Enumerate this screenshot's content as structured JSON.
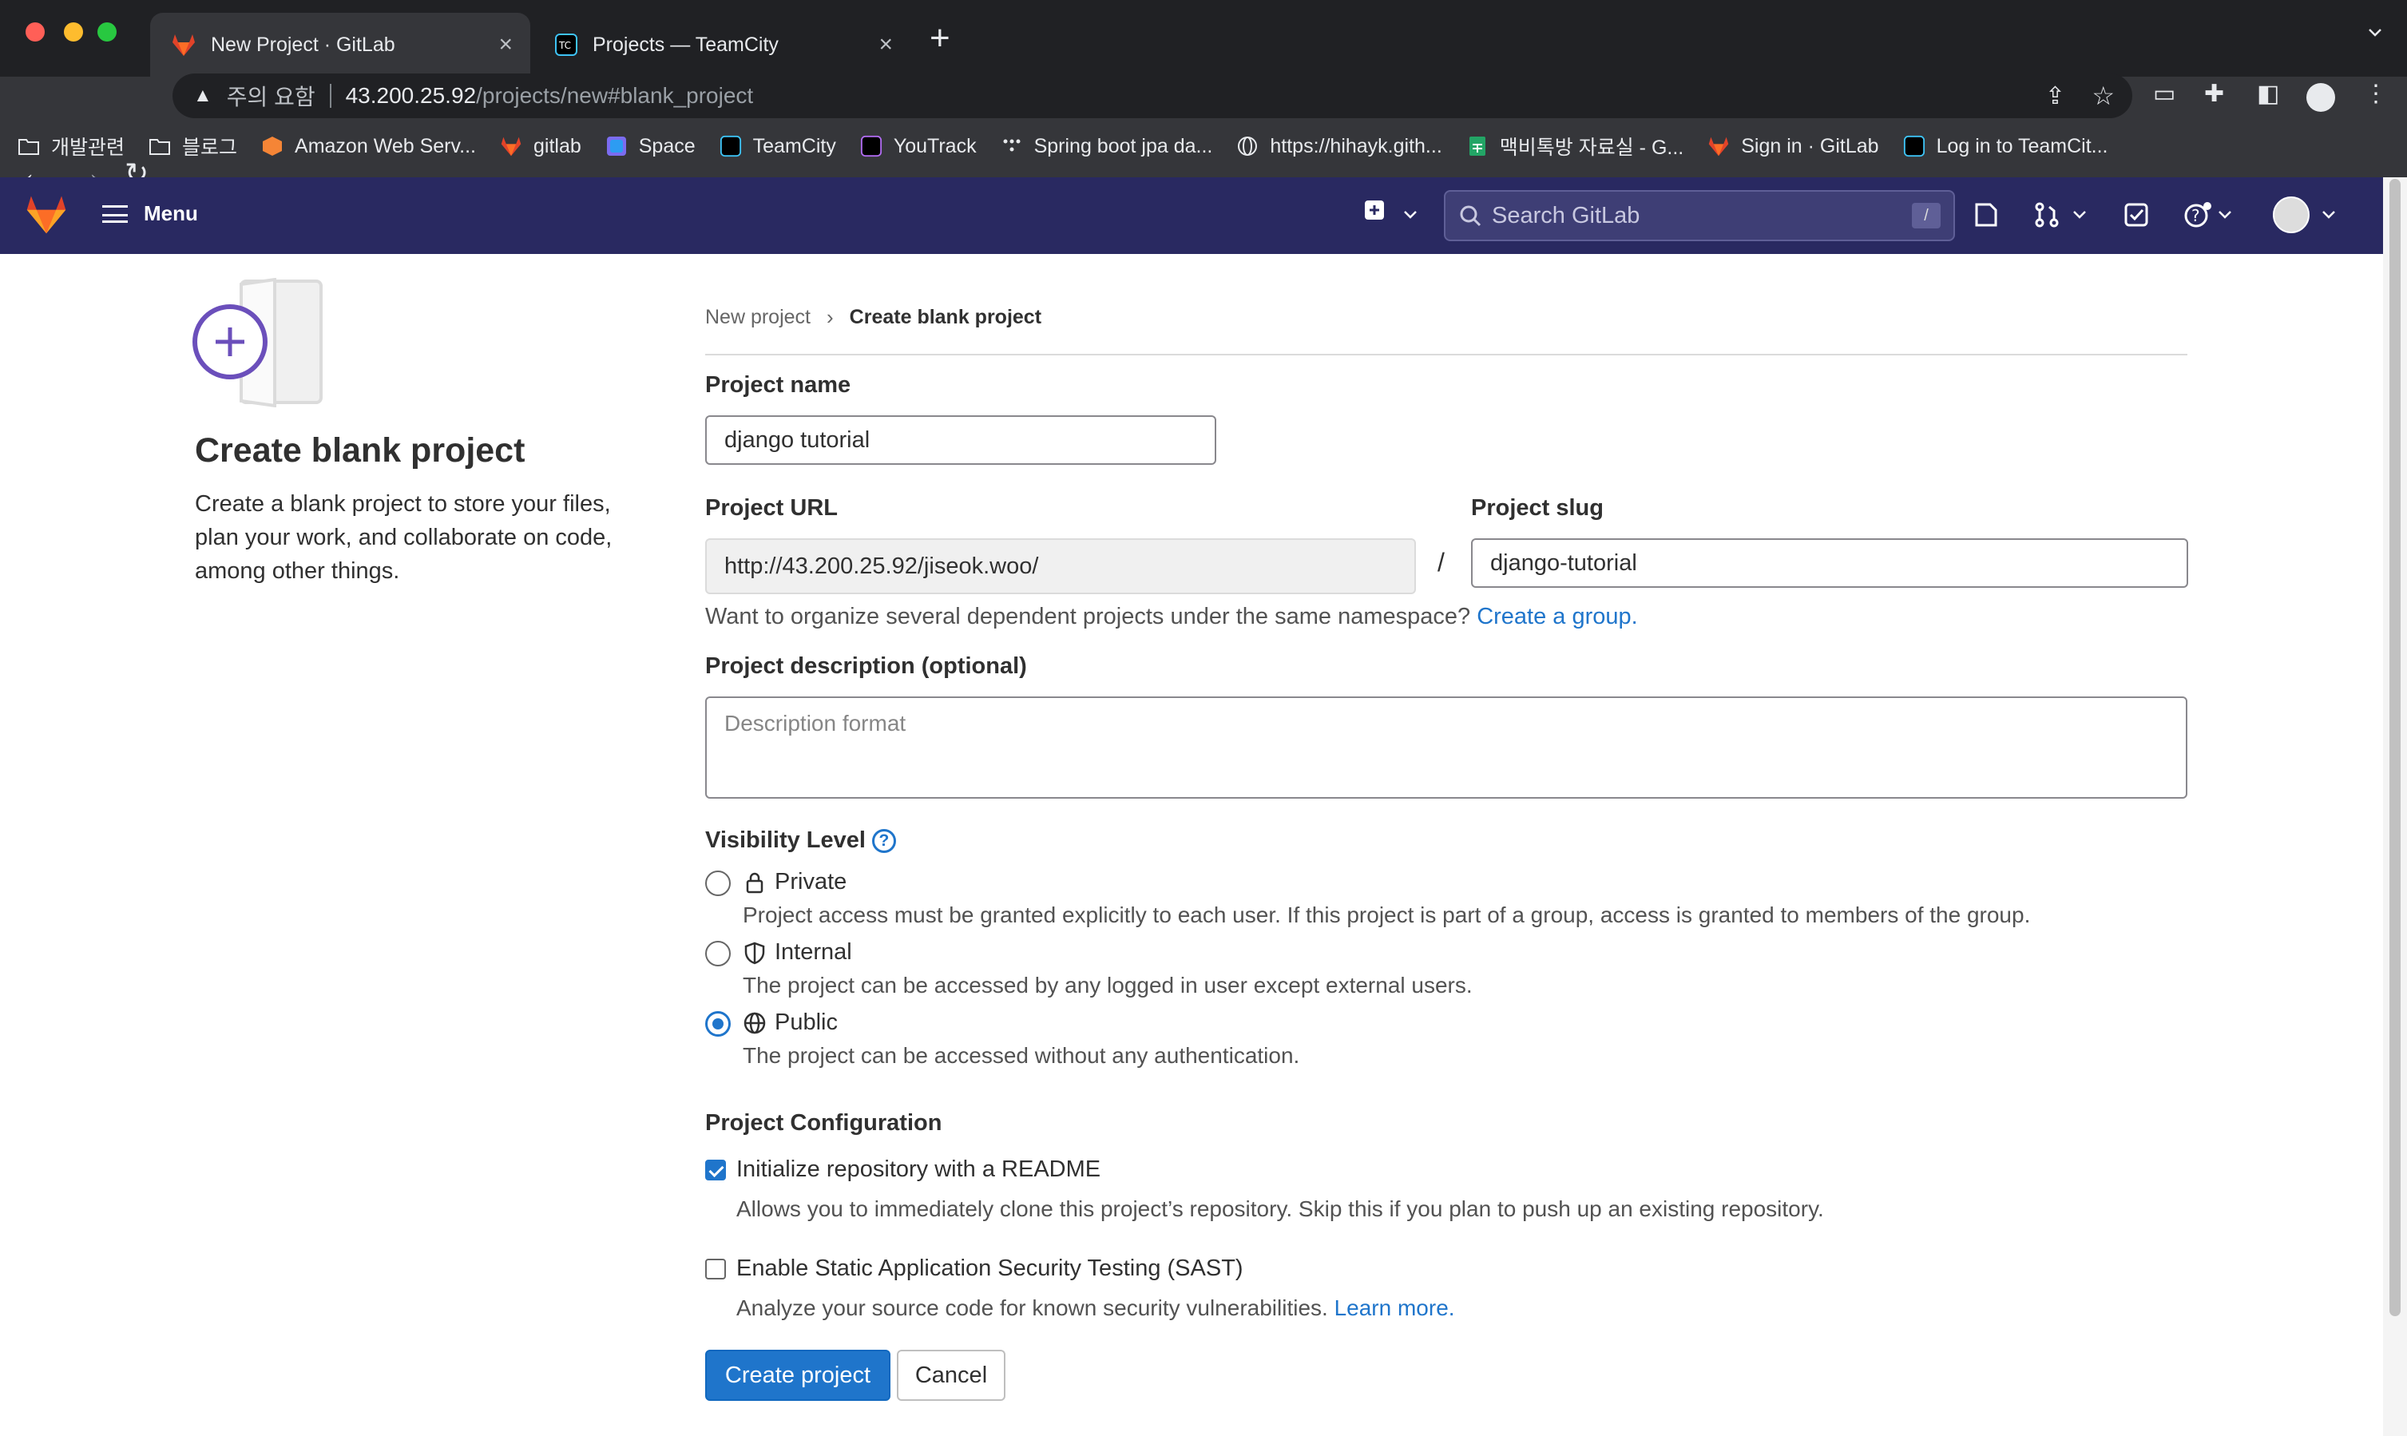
{
  "browser": {
    "tabs": [
      {
        "title": "New Project · GitLab",
        "icon": "gitlab-icon",
        "active": true
      },
      {
        "title": "Projects — TeamCity",
        "icon": "teamcity-icon",
        "active": false
      }
    ],
    "address": {
      "warning_label": "주의 요함",
      "host": "43.200.25.92",
      "path": "/projects/new#blank_project"
    },
    "bookmarks": [
      {
        "label": "개발관련",
        "icon": "folder-icon"
      },
      {
        "label": "블로그",
        "icon": "folder-icon"
      },
      {
        "label": "Amazon Web Serv...",
        "icon": "aws-icon"
      },
      {
        "label": "gitlab",
        "icon": "gitlab-icon"
      },
      {
        "label": "Space",
        "icon": "space-icon"
      },
      {
        "label": "TeamCity",
        "icon": "teamcity-icon"
      },
      {
        "label": "YouTrack",
        "icon": "youtrack-icon"
      },
      {
        "label": "Spring boot jpa da...",
        "icon": "dots-icon"
      },
      {
        "label": "https://hihayk.gith...",
        "icon": "globe-icon"
      },
      {
        "label": "맥비톡방 자료실 - G...",
        "icon": "sheets-icon"
      },
      {
        "label": "Sign in · GitLab",
        "icon": "gitlab-icon"
      },
      {
        "label": "Log in to TeamCit...",
        "icon": "teamcity-icon"
      }
    ]
  },
  "gitlab_header": {
    "menu_label": "Menu",
    "search_placeholder": "Search GitLab",
    "search_shortcut": "/"
  },
  "intro": {
    "title": "Create blank project",
    "description": "Create a blank project to store your files, plan your work, and collaborate on code, among other things."
  },
  "breadcrumb": {
    "parent": "New project",
    "current": "Create blank project"
  },
  "form": {
    "project_name": {
      "label": "Project name",
      "value": "django tutorial"
    },
    "project_url": {
      "label": "Project URL",
      "value": "http://43.200.25.92/jiseok.woo/"
    },
    "url_separator": "/",
    "project_slug": {
      "label": "Project slug",
      "value": "django-tutorial"
    },
    "namespace_help": {
      "text": "Want to organize several dependent projects under the same namespace?",
      "link": "Create a group."
    },
    "description": {
      "label": "Project description (optional)",
      "placeholder": "Description format"
    },
    "visibility": {
      "label": "Visibility Level",
      "help_icon": "question-circle-icon",
      "selected": "Public",
      "options": [
        {
          "label": "Private",
          "icon": "lock-icon",
          "description": "Project access must be granted explicitly to each user. If this project is part of a group, access is granted to members of the group."
        },
        {
          "label": "Internal",
          "icon": "shield-icon",
          "description": "The project can be accessed by any logged in user except external users."
        },
        {
          "label": "Public",
          "icon": "globe-icon",
          "description": "The project can be accessed without any authentication."
        }
      ]
    },
    "configuration": {
      "label": "Project Configuration",
      "readme": {
        "label": "Initialize repository with a README",
        "checked": true,
        "description": "Allows you to immediately clone this project’s repository. Skip this if you plan to push up an existing repository."
      },
      "sast": {
        "label": "Enable Static Application Security Testing (SAST)",
        "checked": false,
        "description": "Analyze your source code for known security vulnerabilities.",
        "link": "Learn more."
      }
    },
    "buttons": {
      "create": "Create project",
      "cancel": "Cancel"
    }
  },
  "colors": {
    "header_bg": "#292961",
    "accent": "#1f75cb",
    "chrome_bg": "#202124"
  }
}
